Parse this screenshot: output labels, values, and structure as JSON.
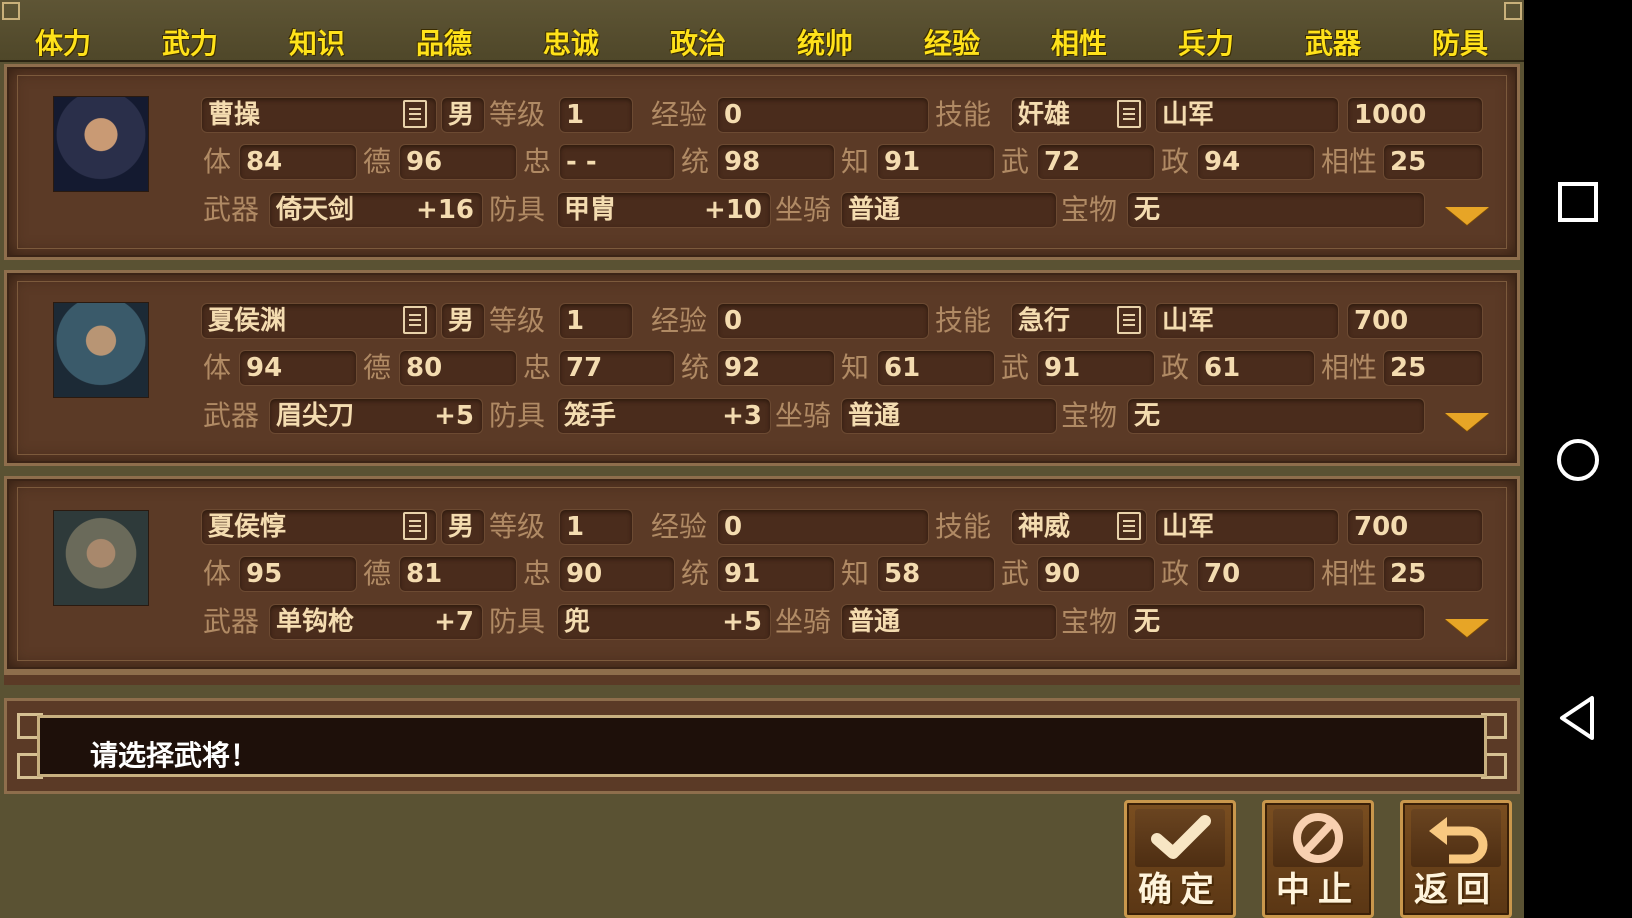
{
  "header": {
    "columns": [
      "体力",
      "武力",
      "知识",
      "品德",
      "忠诚",
      "政治",
      "统帅",
      "经验",
      "相性",
      "兵力",
      "武器",
      "防具"
    ]
  },
  "labels": {
    "level": "等级",
    "exp": "经验",
    "skill": "技能",
    "ti": "体",
    "de": "德",
    "zhong": "忠",
    "tong": "统",
    "zhi": "知",
    "wu": "武",
    "zheng": "政",
    "affinity": "相性",
    "weapon": "武器",
    "armor": "防具",
    "mount": "坐骑",
    "treasure": "宝物"
  },
  "generals": [
    {
      "name": "曹操",
      "gender": "男",
      "level": "1",
      "exp": "0",
      "skill": "奸雄",
      "troop_type": "山军",
      "troops": "1000",
      "ti": "84",
      "de": "96",
      "zhong": "- -",
      "tong": "98",
      "zhi": "91",
      "wu": "72",
      "zheng": "94",
      "affinity": "25",
      "weapon": "倚天剑",
      "weapon_plus": "+16",
      "armor": "甲胄",
      "armor_plus": "+10",
      "mount": "普通",
      "treasure": "无"
    },
    {
      "name": "夏侯渊",
      "gender": "男",
      "level": "1",
      "exp": "0",
      "skill": "急行",
      "troop_type": "山军",
      "troops": "700",
      "ti": "94",
      "de": "80",
      "zhong": "77",
      "tong": "92",
      "zhi": "61",
      "wu": "91",
      "zheng": "61",
      "affinity": "25",
      "weapon": "眉尖刀",
      "weapon_plus": "+5",
      "armor": "笼手",
      "armor_plus": "+3",
      "mount": "普通",
      "treasure": "无"
    },
    {
      "name": "夏侯惇",
      "gender": "男",
      "level": "1",
      "exp": "0",
      "skill": "神威",
      "troop_type": "山军",
      "troops": "700",
      "ti": "95",
      "de": "81",
      "zhong": "90",
      "tong": "91",
      "zhi": "58",
      "wu": "90",
      "zheng": "70",
      "affinity": "25",
      "weapon": "单钩枪",
      "weapon_plus": "+7",
      "armor": "兜",
      "armor_plus": "+5",
      "mount": "普通",
      "treasure": "无"
    }
  ],
  "message": "请选择武将！",
  "buttons": {
    "confirm": "确定",
    "stop": "中止",
    "back": "返回"
  },
  "icons": {
    "detail": "list-icon",
    "expand": "triangle-down-icon",
    "confirm": "checkmark-icon",
    "stop": "prohibited-icon",
    "back": "return-arrow-icon",
    "nav_recent": "square-icon",
    "nav_home": "circle-icon",
    "nav_back": "triangle-left-icon"
  },
  "colors": {
    "header_text": "#ffe21a",
    "field_text": "#f4dcb0",
    "label_text": "#b08a64",
    "card_bg": "#5b3a26",
    "arrow": "#e7a526"
  }
}
